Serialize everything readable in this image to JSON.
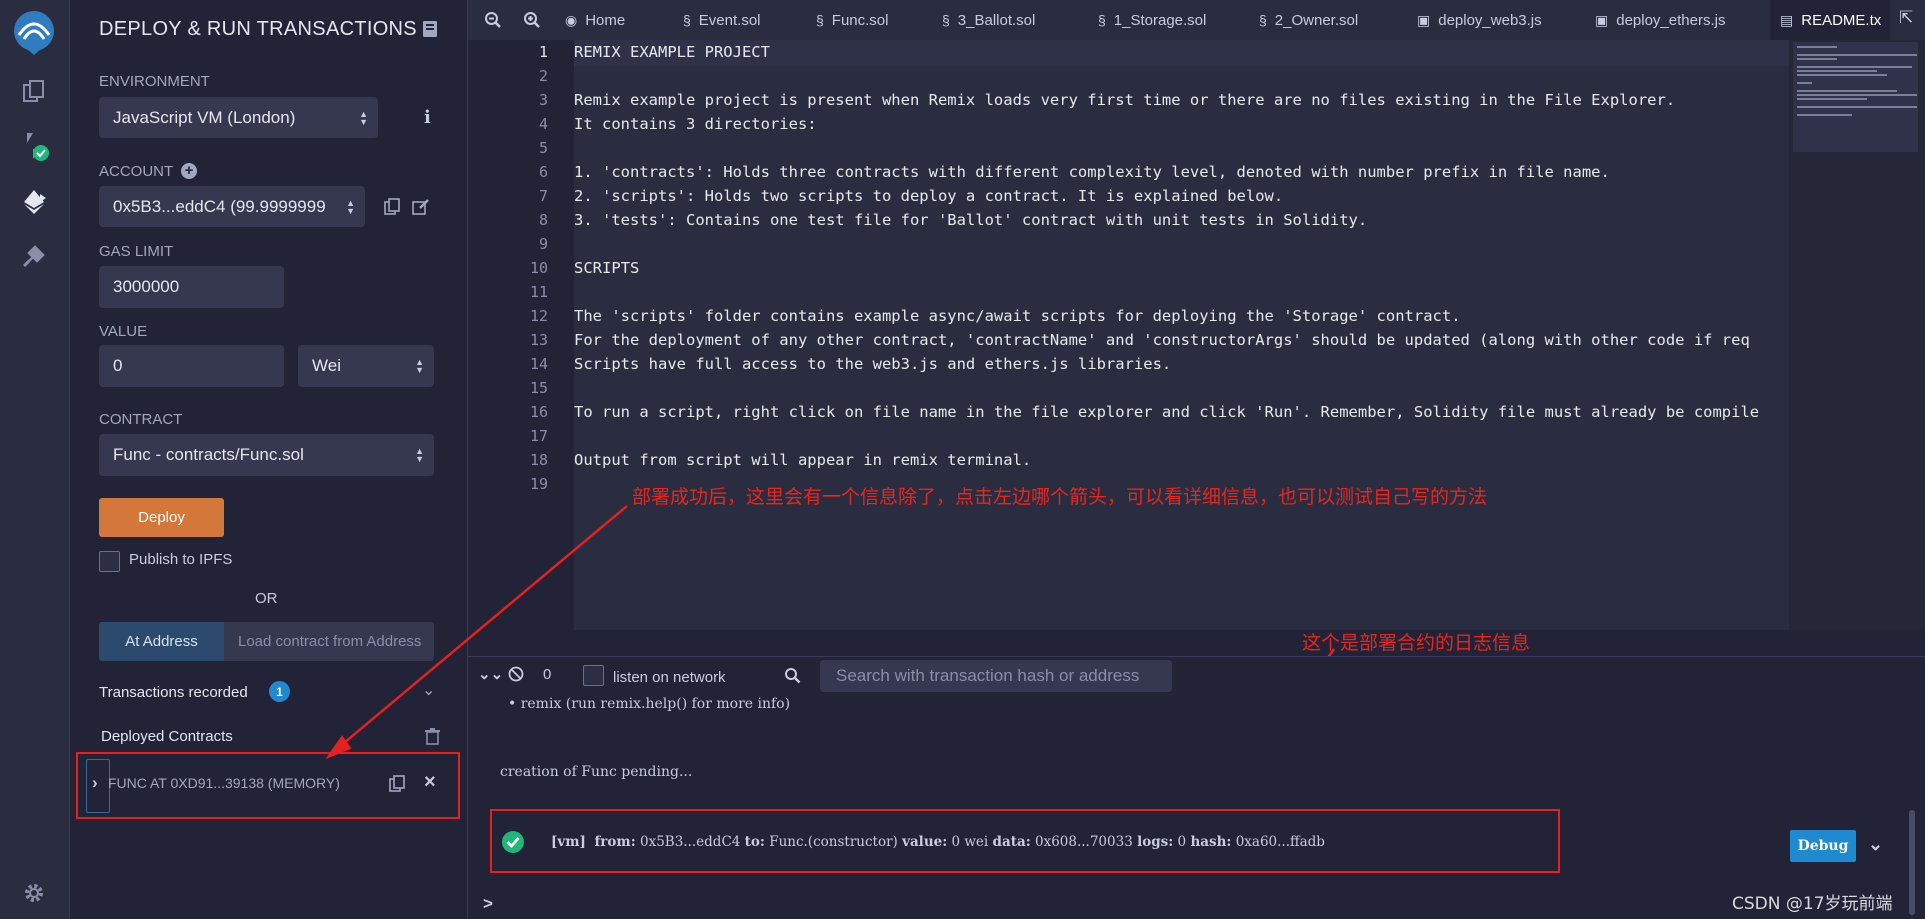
{
  "panel": {
    "title": "DEPLOY & RUN TRANSACTIONS",
    "environment_label": "ENVIRONMENT",
    "environment_value": "JavaScript VM (London)",
    "account_label": "ACCOUNT",
    "account_value": "0x5B3...eddC4 (99.9999999",
    "gas_limit_label": "GAS LIMIT",
    "gas_limit_value": "3000000",
    "value_label": "VALUE",
    "value_value": "0",
    "value_unit": "Wei",
    "contract_label": "CONTRACT",
    "contract_value": "Func - contracts/Func.sol",
    "deploy_button": "Deploy",
    "publish_ipfs": "Publish to IPFS",
    "or": "OR",
    "at_address_button": "At Address",
    "at_address_placeholder": "Load contract from Address",
    "transactions_recorded": "Transactions recorded",
    "transactions_count": "1",
    "deployed_contracts": "Deployed Contracts",
    "deployed_instance": "FUNC AT 0XD91...39138 (MEMORY)"
  },
  "tabs": [
    {
      "label": "Home",
      "icon": "remix-logo-icon"
    },
    {
      "label": "Event.sol",
      "icon": "solidity-icon"
    },
    {
      "label": "Func.sol",
      "icon": "solidity-icon"
    },
    {
      "label": "3_Ballot.sol",
      "icon": "solidity-icon"
    },
    {
      "label": "1_Storage.sol",
      "icon": "solidity-icon"
    },
    {
      "label": "2_Owner.sol",
      "icon": "solidity-icon"
    },
    {
      "label": "deploy_web3.js",
      "icon": "js-file-icon"
    },
    {
      "label": "deploy_ethers.js",
      "icon": "js-file-icon"
    },
    {
      "label": "README.tx",
      "icon": "text-file-icon"
    }
  ],
  "editor": {
    "lines": [
      "REMIX EXAMPLE PROJECT",
      "",
      "Remix example project is present when Remix loads very first time or there are no files existing in the File Explorer.",
      "It contains 3 directories:",
      "",
      "1. 'contracts': Holds three contracts with different complexity level, denoted with number prefix in file name.",
      "2. 'scripts': Holds two scripts to deploy a contract. It is explained below.",
      "3. 'tests': Contains one test file for 'Ballot' contract with unit tests in Solidity.",
      "",
      "SCRIPTS",
      "",
      "The 'scripts' folder contains example async/await scripts for deploying the 'Storage' contract.",
      "For the deployment of any other contract, 'contractName' and 'constructorArgs' should be updated (along with other code if req",
      "Scripts have full access to the web3.js and ethers.js libraries.",
      "",
      "To run a script, right click on file name in the file explorer and click 'Run'. Remember, Solidity file must already be compile",
      "",
      "Output from script will appear in remix terminal.",
      ""
    ]
  },
  "annotations": {
    "editor_note": "部署成功后，这里会有一个信息除了，点击左边哪个箭头，可以看详细信息，也可以测试自己写的方法",
    "log_note": "这个是部署合约的日志信息"
  },
  "terminal": {
    "pending_count": "0",
    "listen_label": "listen on network",
    "search_placeholder": "Search with transaction hash or address",
    "line_remix": "• remix (run remix.help() for more info)",
    "line_pending": "creation of Func pending...",
    "log": {
      "tag": "[vm]",
      "from_label": "from:",
      "from": "0x5B3...eddC4",
      "to_label": "to:",
      "to": "Func.(constructor)",
      "value_label": "value:",
      "value": "0 wei",
      "data_label": "data:",
      "data": "0x608...70033",
      "logs_label": "logs:",
      "logs": "0",
      "hash_label": "hash:",
      "hash": "0xa60...ffadb"
    },
    "debug_button": "Debug",
    "prompt": ">"
  },
  "watermark": "CSDN @17岁玩前端",
  "colors": {
    "accent": "#1f8ad0",
    "deploy": "#d4773a",
    "annotation": "#e52020",
    "success": "#1fb87a"
  }
}
